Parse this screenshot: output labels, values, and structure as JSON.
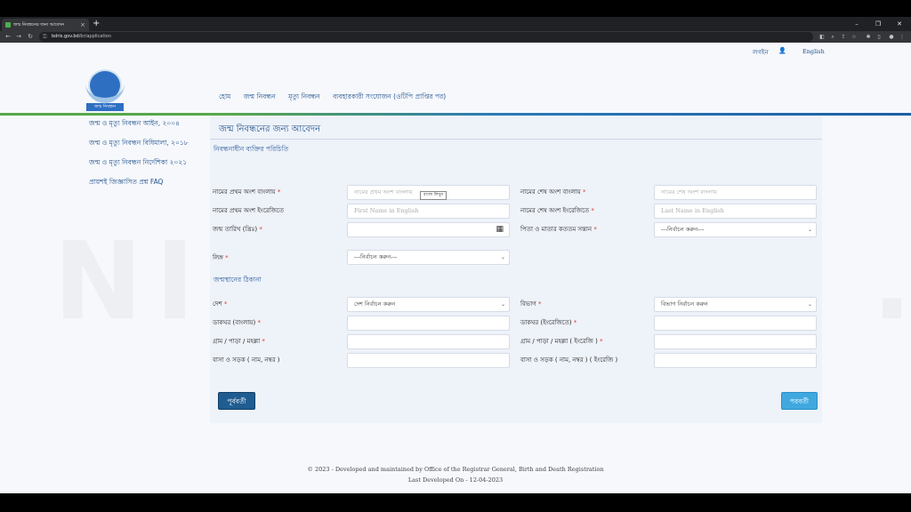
{
  "browser": {
    "tab_title": "জন্ম নিবন্ধনের জন্য আবেদন",
    "tab_close": "×",
    "new_tab": "+",
    "url_host": "bdris.gov.bd",
    "url_path": "/br/application",
    "min_icon": "–",
    "max_icon": "❐",
    "close_icon": "✕",
    "back_icon": "←",
    "forward_icon": "→",
    "reload_icon": "↻",
    "lock_icon": "🔒"
  },
  "header": {
    "login": "লগইন",
    "language": "English",
    "logo_caption": "জন্ম নিবন্ধন",
    "nav": [
      "হোম",
      "জন্ম নিবন্ধন",
      "মৃত্যু নিবন্ধন",
      "ব্যবহারকারী সংযোজন (ওটিপি প্রাপ্তির পর)"
    ]
  },
  "sidebar": {
    "items": [
      "জন্ম ও মৃত্যু নিবন্ধন আইন, ২০০৪",
      "জন্ম ও মৃত্যু নিবন্ধন বিধিমালা, ২০১৮",
      "জন্ম ও মৃত্যু নিবন্ধন নির্দেশিকা ২০২১",
      "প্রায়শই জিজ্ঞাসিত প্রশ্ন FAQ"
    ]
  },
  "form": {
    "title": "জন্ম নিবন্ধনের জন্য আবেদন",
    "section_person": "নিবন্ধনাধীন ব্যক্তির পরিচিতি",
    "section_birthplace": "জন্মস্থানের ঠিকানা",
    "tooltip": "বাংলা লিখুন",
    "fields": {
      "first_name_bn": {
        "label": "নামের প্রথম অংশ বাংলায়",
        "placeholder": "নামের প্রথম অংশ বাংলায়"
      },
      "last_name_bn": {
        "label": "নামের শেষ অংশ বাংলায়",
        "placeholder": "নামের শেষ অংশ বাংলায়"
      },
      "first_name_en": {
        "label": "নামের প্রথম অংশ ইংরেজিতে",
        "placeholder": "First Name in English"
      },
      "last_name_en": {
        "label": "নামের শেষ অংশ ইংরেজিতে",
        "placeholder": "Last Name in English"
      },
      "dob": {
        "label": "জন্ম তারিখ (খ্রিঃ)",
        "value": ""
      },
      "birth_order": {
        "label": "পিতা ও মাতার কততম সন্তান",
        "value": "---নির্বাচন করুন---"
      },
      "gender": {
        "label": "লিঙ্গ",
        "value": "---নির্বাচন করুন---"
      },
      "country": {
        "label": "দেশ",
        "value": "দেশ নির্বাচন করুন"
      },
      "division": {
        "label": "বিভাগ",
        "value": "বিভাগ নির্বাচন করুন"
      },
      "post_office_bn": {
        "label": "ডাকঘর (বাংলায়)"
      },
      "post_office_en": {
        "label": "ডাকঘর (ইংরেজিতে)"
      },
      "village_bn": {
        "label": "গ্রাম / পাড়া / মহল্লা"
      },
      "village_en": {
        "label": "গ্রাম / পাড়া / মহল্লা ( ইংরেজি )"
      },
      "house_road_bn": {
        "label": "বাসা ও সড়ক ( নাম, নম্বর )"
      },
      "house_road_en": {
        "label": "বাসা ও সড়ক ( নাম, নম্বর ) ( ইংরেজি )"
      }
    },
    "required_mark": "*",
    "prev_button": "পূর্ববর্তী",
    "next_button": "পরবর্তী"
  },
  "footer": {
    "line1": "© 2023 - Developed and maintained by Office of the Registrar General, Birth and Death Registration",
    "line2": "Last Developed On - 12-04-2023"
  },
  "watermark": "NID CHECK .com"
}
